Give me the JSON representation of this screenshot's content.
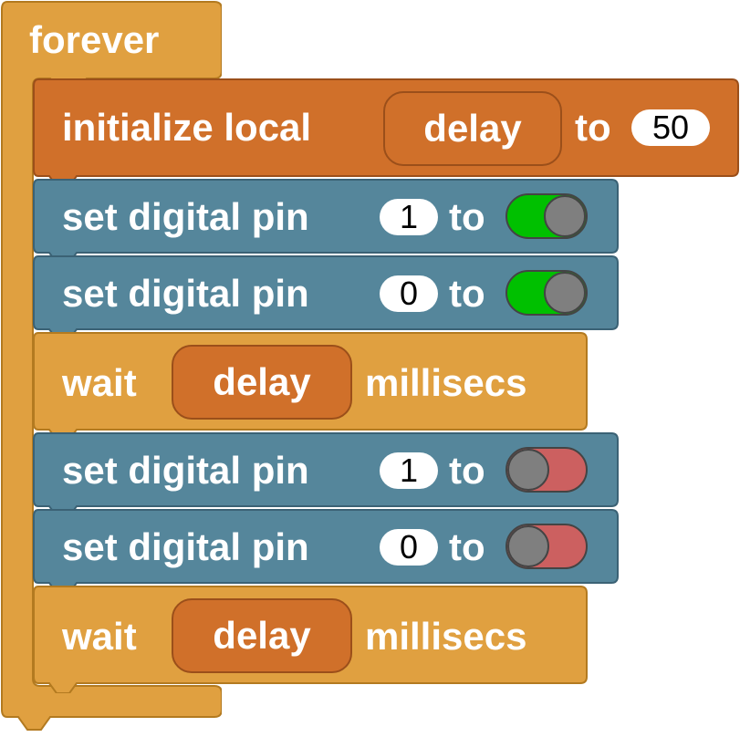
{
  "forever_block": {
    "label": "forever"
  },
  "init_local": {
    "label": "initialize local",
    "var_name": "delay",
    "to": "to",
    "value": "50"
  },
  "pin_blocks": [
    {
      "label": "set digital pin",
      "pin": "1",
      "to": "to",
      "state": "on"
    },
    {
      "label": "set digital pin",
      "pin": "0",
      "to": "to",
      "state": "on"
    },
    {
      "label": "set digital pin",
      "pin": "1",
      "to": "to",
      "state": "off"
    },
    {
      "label": "set digital pin",
      "pin": "0",
      "to": "to",
      "state": "off"
    }
  ],
  "wait_blocks": [
    {
      "label": "wait",
      "var_name": "delay",
      "unit": "millisecs"
    },
    {
      "label": "wait",
      "var_name": "delay",
      "unit": "millisecs"
    }
  ],
  "colors": {
    "control": "#e0a040",
    "variables": "#d0702a",
    "io": "#55869b",
    "toggle_on": "#00c000",
    "toggle_off": "#cc6060"
  }
}
